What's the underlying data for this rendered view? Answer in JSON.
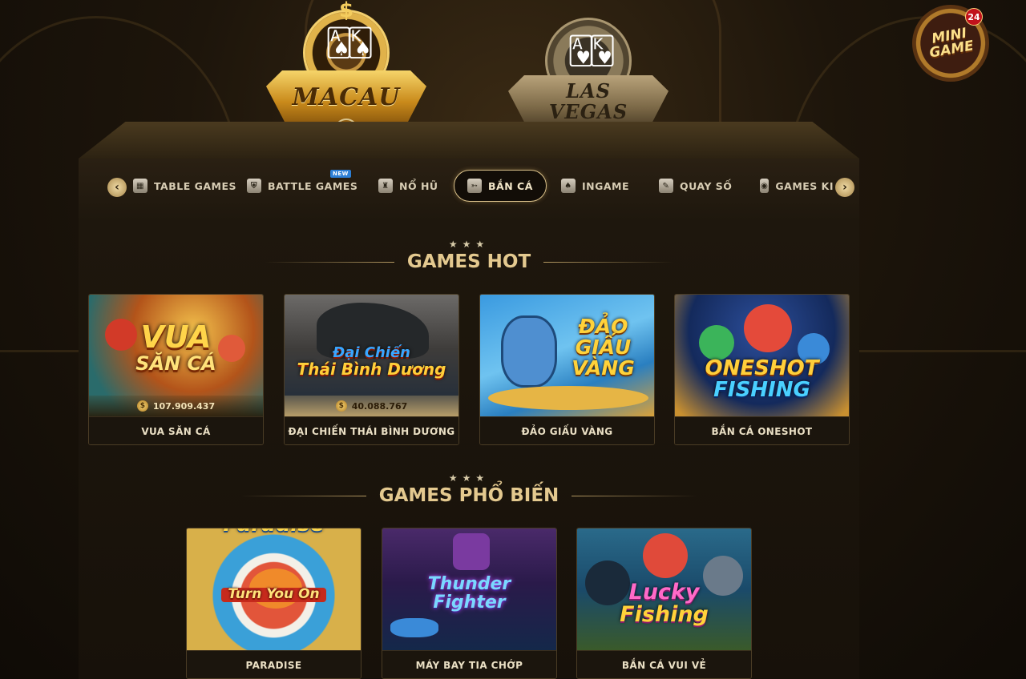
{
  "lobbies": {
    "macau": {
      "label": "MACAU",
      "selected": true
    },
    "vegas": {
      "label_line1": "LAS",
      "label_line2": "VEGAS",
      "selected": false
    }
  },
  "minigame": {
    "line1": "MINI",
    "line2": "GAME",
    "count": "24"
  },
  "tabs": {
    "items": [
      {
        "label": "TABLE GAMES",
        "icon": "table-games-icon"
      },
      {
        "label": "BATTLE GAMES",
        "icon": "battle-games-icon",
        "badge": "NEW"
      },
      {
        "label": "NỔ HŨ",
        "icon": "slot-icon"
      },
      {
        "label": "BẮN CÁ",
        "icon": "fish-icon",
        "active": true
      },
      {
        "label": "INGAME",
        "icon": "cards-icon"
      },
      {
        "label": "QUAY SỐ",
        "icon": "lottery-icon"
      },
      {
        "label": "GAMES KI",
        "icon": "games-ki-icon"
      }
    ]
  },
  "sections": {
    "hot": {
      "title": "GAMES HOT"
    },
    "popular": {
      "title": "GAMES PHỔ BIẾN"
    }
  },
  "hot_games": [
    {
      "name": "VUA SĂN CÁ",
      "art_line1": "VUA",
      "art_line2": "SĂN CÁ",
      "jackpot": "107.909.437"
    },
    {
      "name": "ĐẠI CHIẾN THÁI BÌNH DƯƠNG",
      "art_line1": "Đại Chiến",
      "art_line2": "Thái Bình Dương",
      "jackpot": "40.088.767"
    },
    {
      "name": "ĐẢO GIẤU VÀNG",
      "art_line1": "ĐẢO",
      "art_line2": "GIẤU",
      "art_line3": "VÀNG"
    },
    {
      "name": "BẮN CÁ ONESHOT",
      "art_line1": "ONESHOT",
      "art_line2": "FISHING"
    }
  ],
  "popular_games": [
    {
      "name": "PARADISE",
      "art_line1": "Paradise",
      "art_line2": "Turn You On"
    },
    {
      "name": "MÁY BAY TIA CHỚP",
      "art_line1": "Thunder",
      "art_line2": "Fighter"
    },
    {
      "name": "BẮN CÁ VUI VẺ",
      "art_line1": "Lucky",
      "art_line2": "Fishing"
    }
  ],
  "colors": {
    "accent_gold": "#e4c98f",
    "panel_bg": "#17110a",
    "active_tab_border": "#d9c08a"
  }
}
